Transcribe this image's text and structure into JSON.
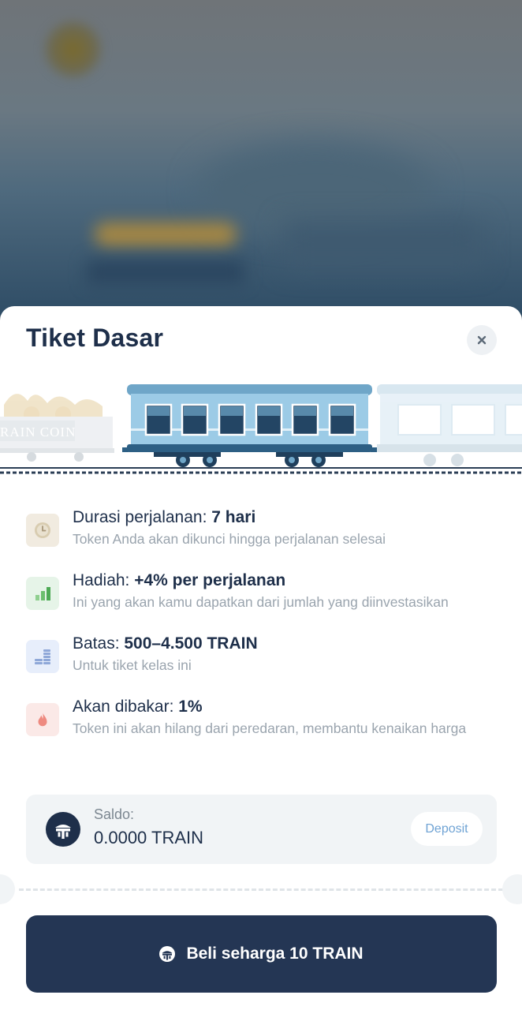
{
  "modal": {
    "title": "Tiket Dasar",
    "close_icon": "close-icon"
  },
  "train": {
    "coin_car_label": "RAIN COIN"
  },
  "features": [
    {
      "icon": "clock-icon",
      "label": "Durasi perjalanan: ",
      "value": "7 hari",
      "description": "Token Anda akan dikunci hingga perjalanan selesai"
    },
    {
      "icon": "bar-chart-icon",
      "label": "Hadiah: ",
      "value": "+4% per perjalanan",
      "description": "Ini yang akan kamu dapatkan dari jumlah yang diinvestasikan"
    },
    {
      "icon": "coin-stack-icon",
      "label": "Batas: ",
      "value": "500–4.500 TRAIN",
      "description": "Untuk tiket kelas ini"
    },
    {
      "icon": "flame-icon",
      "label": "Akan dibakar: ",
      "value": "1%",
      "description": "Token ini akan hilang dari peredaran, membantu kenaikan harga"
    }
  ],
  "balance": {
    "label": "Saldo:",
    "value": "0.0000 TRAIN",
    "deposit_label": "Deposit"
  },
  "buy_button": {
    "label": "Beli seharga 10 TRAIN"
  },
  "colors": {
    "primary": "#243654",
    "title": "#1e2f4a",
    "muted": "#9aa4ae",
    "deposit": "#6fa3d4",
    "train_body": "#9ccbe6"
  }
}
